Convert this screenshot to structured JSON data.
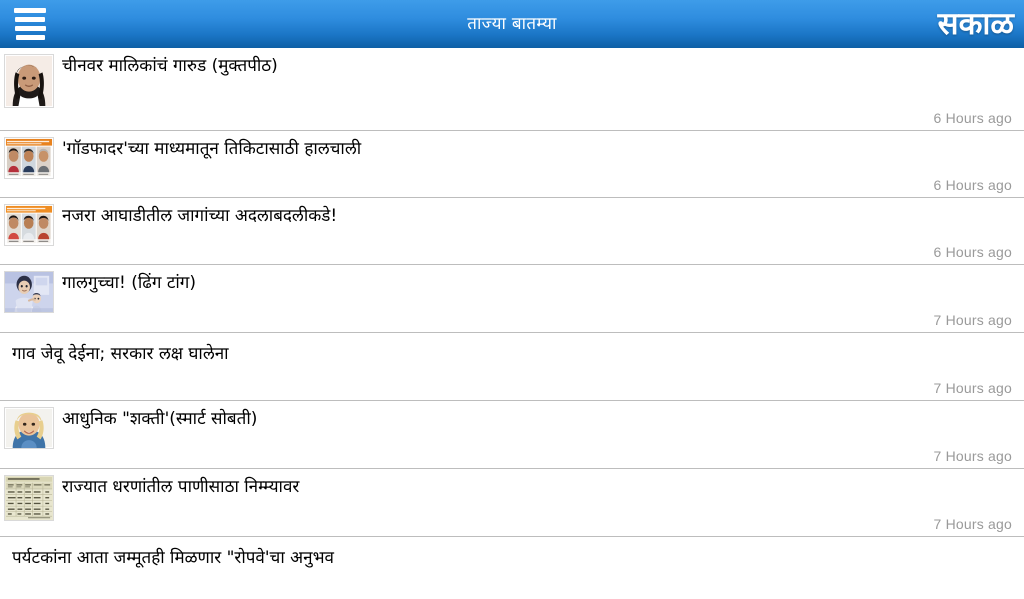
{
  "header": {
    "title": "ताज्या बातम्या",
    "brand": "सकाळ",
    "menu_icon": "hamburger-menu-icon",
    "gradient_top": "#3e9ce9",
    "gradient_bottom": "#0e5fa5",
    "title_color": "#ffffff"
  },
  "list": {
    "timestamp_color": "#9a9a9a",
    "divider_color": "#bdbdbd",
    "items": [
      {
        "title": "चीनवर मालिकांचं गारुड (मुक्तपीठ)",
        "time": "6 Hours ago",
        "thumb": "woman-portrait-photo",
        "has_thumb": true
      },
      {
        "title": "'गॉडफादर'च्या माध्यमातून तिकिटासाठी हालचाली",
        "time": "6 Hours ago",
        "thumb": "three-politician-portraits-photo",
        "has_thumb": true
      },
      {
        "title": "नजरा आघाडीतील जागांच्या अदलाबदलीकडे!",
        "time": "6 Hours ago",
        "thumb": "three-leader-portraits-orange-banner-photo",
        "has_thumb": true
      },
      {
        "title": "गालगुच्चा! (ढिंग टांग)",
        "time": "7 Hours ago",
        "thumb": "cartoon-illustration",
        "has_thumb": true
      },
      {
        "title": "गाव जेवू देईना; सरकार लक्ष घालेना",
        "time": "7 Hours ago",
        "thumb": "",
        "has_thumb": false
      },
      {
        "title": "आधुनिक \"शक्ती'(स्मार्ट सोबती)",
        "time": "7 Hours ago",
        "thumb": "blonde-woman-portrait-photo",
        "has_thumb": true
      },
      {
        "title": "राज्यात धरणांतील पाणीसाठा निम्म्यावर",
        "time": "7 Hours ago",
        "thumb": "data-table-chart-image",
        "has_thumb": true
      },
      {
        "title": "पर्यटकांना आता जम्मूतही मिळणार \"रोपवे'चा अनुभव",
        "time": "",
        "thumb": "",
        "has_thumb": false
      }
    ]
  }
}
